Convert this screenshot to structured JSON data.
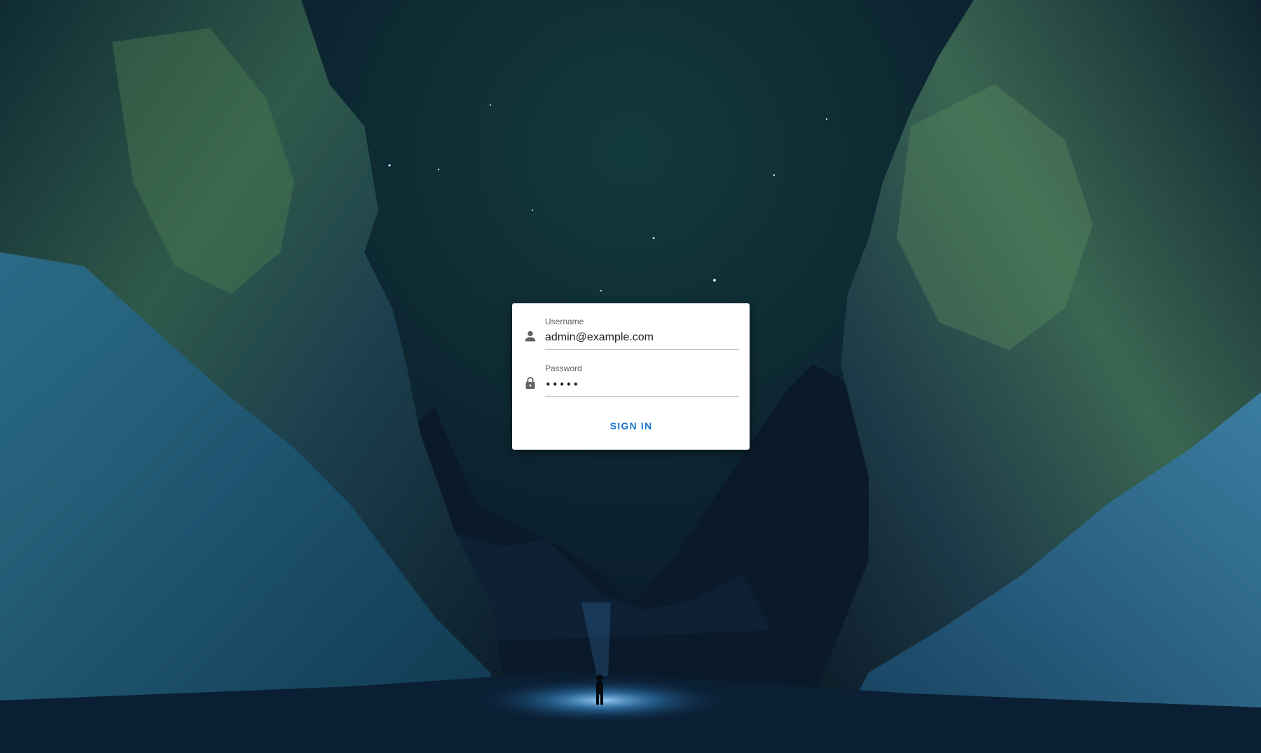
{
  "login": {
    "username": {
      "label": "Username",
      "value": "admin@example.com",
      "icon": "person-icon"
    },
    "password": {
      "label": "Password",
      "value": "•••••",
      "icon": "lock-icon"
    },
    "submit_label": "SIGN IN"
  },
  "colors": {
    "accent": "#1976d2",
    "card_background": "#ffffff",
    "icon": "#616161"
  }
}
